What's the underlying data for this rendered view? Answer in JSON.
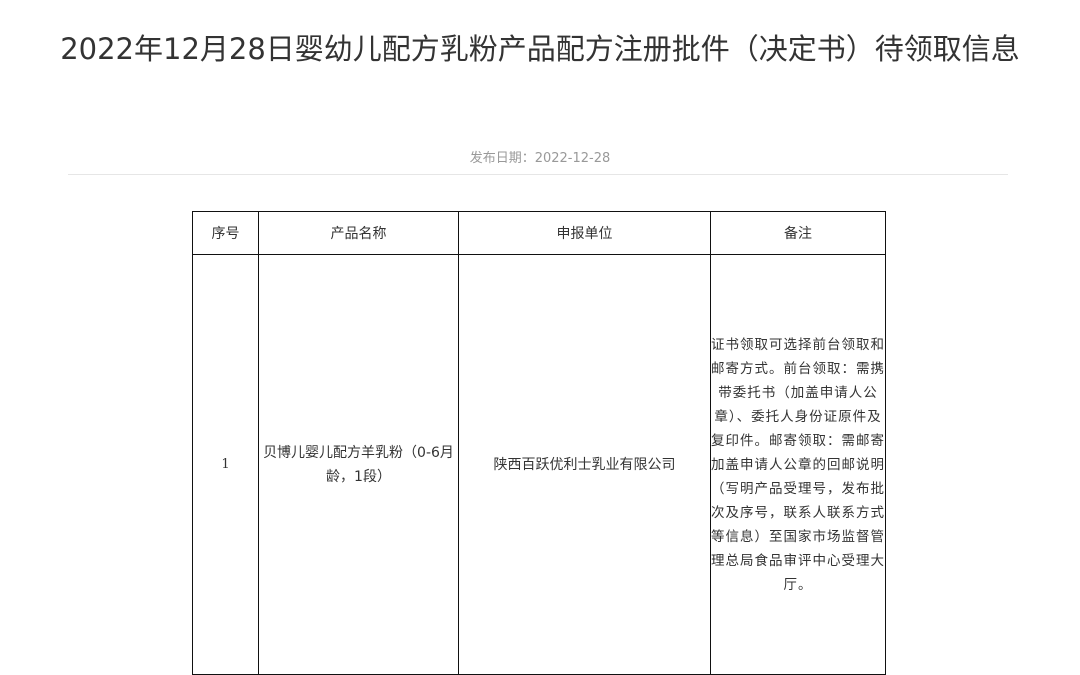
{
  "article": {
    "title": "2022年12月28日婴幼儿配方乳粉产品配方注册批件（决定书）待领取信息",
    "date_label": "发布日期：",
    "date_value": "2022-12-28"
  },
  "table": {
    "headers": {
      "no": "序号",
      "product": "产品名称",
      "applicant": "申报单位",
      "remark": "备注"
    },
    "rows": [
      {
        "no": "1",
        "product": "贝博儿婴儿配方羊乳粉（0-6月龄，1段）",
        "applicant": "陕西百跃优利士乳业有限公司",
        "remark": "证书领取可选择前台领取和邮寄方式。前台领取：需携带委托书（加盖申请人公章）、委托人身份证原件及复印件。邮寄领取：需邮寄加盖申请人公章的回邮说明（写明产品受理号，发布批次及序号，联系人联系方式等信息）至国家市场监督管理总局食品审评中心受理大厅。"
      }
    ]
  }
}
